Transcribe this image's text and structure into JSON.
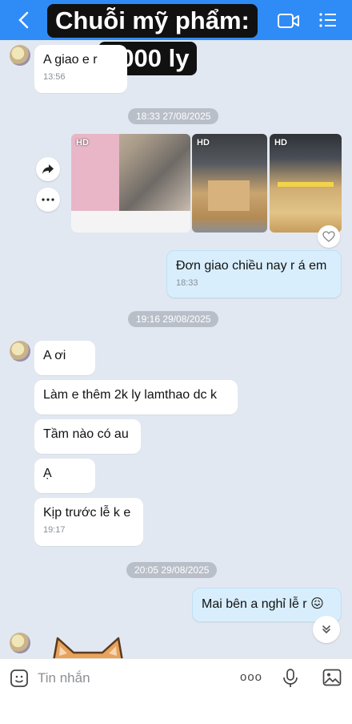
{
  "header": {
    "caption_line1": "Chuỗi mỹ phẩm:",
    "caption_line2": "5000 ly",
    "back_label": "<"
  },
  "messages": {
    "m1_text": "A giao e r",
    "m1_time": "13:56",
    "date1": "18:33 27/08/2025",
    "hd_label": "HD",
    "m2_text": "Đơn giao chiều nay r á em",
    "m2_time": "18:33",
    "date2": "19:16 29/08/2025",
    "m3_text": "A ơi",
    "m4_text": "Làm e thêm 2k ly lamthao dc k",
    "m5_text": "Tầm nào có au",
    "m6_text": "Ạ",
    "m7_text": "Kịp trước lễ k e",
    "m7_time": "19:17",
    "date3": "20:05 29/08/2025",
    "m8_text": "Mai bên a nghỉ lễ r",
    "m8_emoji": "😖"
  },
  "input": {
    "placeholder": "Tin nhắn",
    "more_label": "ooo"
  },
  "colors": {
    "header": "#2f8cf6",
    "background": "#e2e8f1",
    "my_bubble": "#d8eefc"
  }
}
